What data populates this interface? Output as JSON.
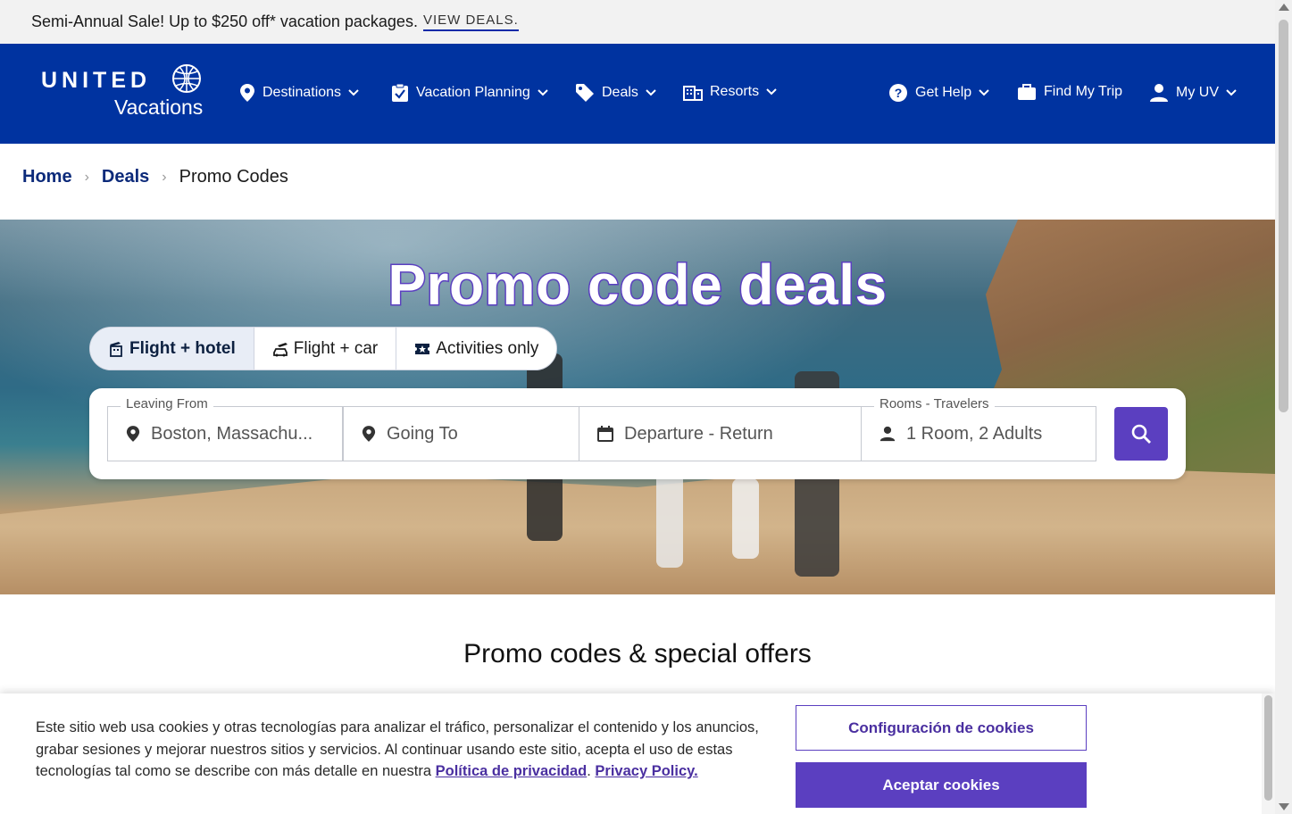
{
  "promo": {
    "text": "Semi-Annual Sale! Up to $250 off* vacation packages.",
    "link": "VIEW DEALS."
  },
  "header": {
    "logo_brand": "UNITED",
    "logo_sub": "Vacations",
    "nav": [
      {
        "label": "Destinations",
        "icon": "map-pin-icon"
      },
      {
        "label": "Vacation Planning",
        "icon": "clipboard-check-icon"
      },
      {
        "label": "Deals",
        "icon": "tag-icon"
      },
      {
        "label": "Resorts",
        "icon": "building-icon"
      }
    ],
    "right_nav": [
      {
        "label": "Get Help",
        "icon": "help-circle-icon"
      },
      {
        "label": "Find My Trip",
        "icon": "briefcase-icon"
      },
      {
        "label": "My UV",
        "icon": "user-icon"
      }
    ]
  },
  "breadcrumb": {
    "home": "Home",
    "deals": "Deals",
    "current": "Promo Codes"
  },
  "hero": {
    "title": "Promo code deals",
    "tabs": [
      {
        "label": "Flight + hotel",
        "active": true,
        "icon": "flight-hotel-icon"
      },
      {
        "label": "Flight + car",
        "active": false,
        "icon": "flight-car-icon"
      },
      {
        "label": "Activities only",
        "active": false,
        "icon": "ticket-icon"
      }
    ],
    "search": {
      "leaving_label": "Leaving From",
      "leaving_value": "Boston, Massachu...",
      "going_placeholder": "Going To",
      "dates_placeholder": "Departure - Return",
      "rooms_label": "Rooms - Travelers",
      "rooms_value": "1 Room, 2 Adults"
    }
  },
  "section": {
    "title": "Promo codes & special offers"
  },
  "cookie": {
    "text": "Este sitio web usa cookies y otras tecnologías para analizar el tráfico, personalizar el contenido y los anuncios, grabar sesiones y mejorar nuestros sitios y servicios. Al continuar usando este sitio, acepta el uso de estas tecnologías tal como se describe con más detalle en nuestra",
    "policy_es": "Política de privacidad",
    "policy_en": "Privacy Policy.",
    "config_button": "Configuración de cookies",
    "accept_button": "Aceptar cookies"
  },
  "colors": {
    "header_bg": "#0033a0",
    "accent_purple": "#5b3fc0",
    "breadcrumb_link": "#0c2a7a"
  }
}
